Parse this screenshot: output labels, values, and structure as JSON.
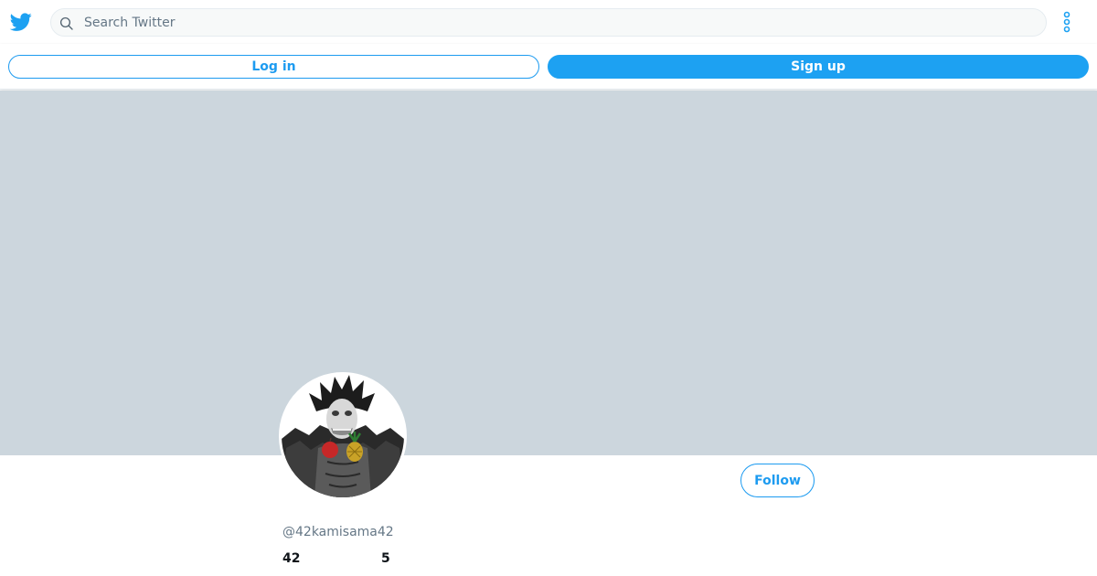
{
  "header": {
    "logo_icon": "twitter-bird-icon",
    "brand_color": "#1da1f2",
    "search_placeholder": "Search Twitter",
    "search_icon": "search-icon",
    "more_icon": "vertical-more-icon"
  },
  "auth": {
    "login_label": "Log in",
    "signup_label": "Sign up"
  },
  "profile": {
    "banner_color": "#ccd6dd",
    "avatar_icon": "profile-avatar",
    "follow_label": "Follow",
    "handle": "@42kamisama42",
    "following_count": "42",
    "followers_count": "5"
  }
}
